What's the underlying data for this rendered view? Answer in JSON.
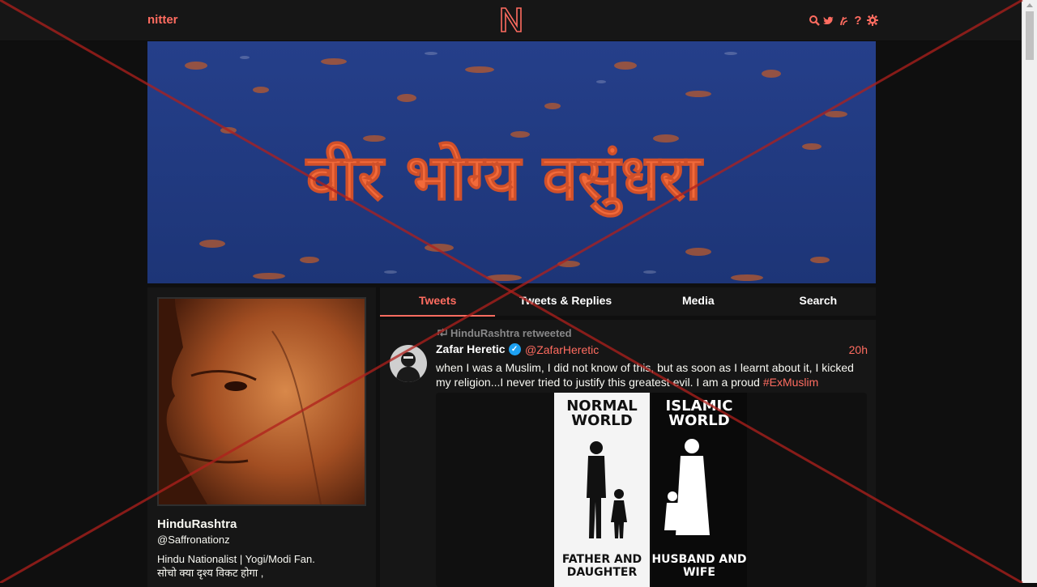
{
  "navbar": {
    "brand": "nitter",
    "icons": [
      "search-icon",
      "bird-icon",
      "rss-icon",
      "help-icon",
      "gear-icon"
    ]
  },
  "banner": {
    "text": "वीर भोग्य वसुंधरा"
  },
  "profile": {
    "fullname": "HinduRashtra",
    "username": "@Saffronationz",
    "bio_line1": "Hindu Nationalist | Yogi/Modi Fan.",
    "bio_line2": "सोचो क्या दृश्य विकट होगा ,"
  },
  "tabs": [
    {
      "label": "Tweets",
      "active": true
    },
    {
      "label": "Tweets & Replies",
      "active": false
    },
    {
      "label": "Media",
      "active": false
    },
    {
      "label": "Search",
      "active": false
    }
  ],
  "tweet": {
    "retweet_header": "HinduRashtra retweeted",
    "fullname": "Zafar Heretic",
    "username": "@ZafarHeretic",
    "date": "20h",
    "text": "when I was a Muslim, I did not know of this, but as soon as I learnt about it, I kicked my religion...I never tried to justify this greatest evil. I am a proud ",
    "hashtag": "#ExMuslim",
    "media": {
      "left_title_1": "NORMAL",
      "left_title_2": "WORLD",
      "left_caption_1": "FATHER AND",
      "left_caption_2": "DAUGHTER",
      "right_title_1": "ISLAMIC",
      "right_title_2": "WORLD",
      "right_caption_1": "HUSBAND AND",
      "right_caption_2": "WIFE"
    }
  },
  "colors": {
    "accent": "#ff6c60",
    "background": "#0f0f0f",
    "panel": "#161616",
    "overlay_cross": "#b0201c"
  }
}
